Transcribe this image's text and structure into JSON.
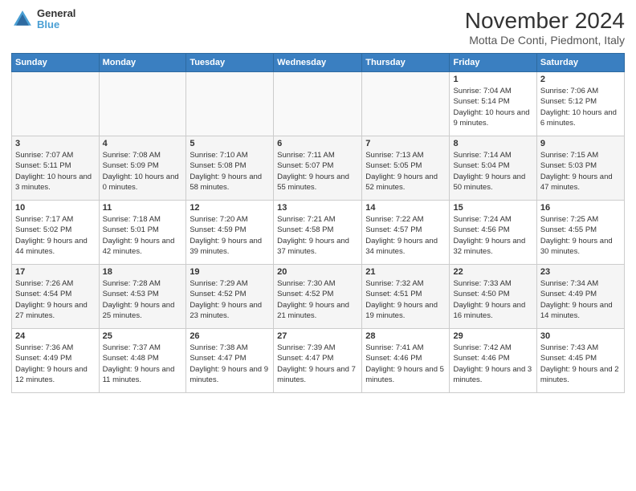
{
  "header": {
    "logo": {
      "line1": "General",
      "line2": "Blue"
    },
    "title": "November 2024",
    "subtitle": "Motta De Conti, Piedmont, Italy"
  },
  "weekdays": [
    "Sunday",
    "Monday",
    "Tuesday",
    "Wednesday",
    "Thursday",
    "Friday",
    "Saturday"
  ],
  "weeks": [
    [
      {
        "day": "",
        "info": ""
      },
      {
        "day": "",
        "info": ""
      },
      {
        "day": "",
        "info": ""
      },
      {
        "day": "",
        "info": ""
      },
      {
        "day": "",
        "info": ""
      },
      {
        "day": "1",
        "info": "Sunrise: 7:04 AM\nSunset: 5:14 PM\nDaylight: 10 hours and 9 minutes."
      },
      {
        "day": "2",
        "info": "Sunrise: 7:06 AM\nSunset: 5:12 PM\nDaylight: 10 hours and 6 minutes."
      }
    ],
    [
      {
        "day": "3",
        "info": "Sunrise: 7:07 AM\nSunset: 5:11 PM\nDaylight: 10 hours and 3 minutes."
      },
      {
        "day": "4",
        "info": "Sunrise: 7:08 AM\nSunset: 5:09 PM\nDaylight: 10 hours and 0 minutes."
      },
      {
        "day": "5",
        "info": "Sunrise: 7:10 AM\nSunset: 5:08 PM\nDaylight: 9 hours and 58 minutes."
      },
      {
        "day": "6",
        "info": "Sunrise: 7:11 AM\nSunset: 5:07 PM\nDaylight: 9 hours and 55 minutes."
      },
      {
        "day": "7",
        "info": "Sunrise: 7:13 AM\nSunset: 5:05 PM\nDaylight: 9 hours and 52 minutes."
      },
      {
        "day": "8",
        "info": "Sunrise: 7:14 AM\nSunset: 5:04 PM\nDaylight: 9 hours and 50 minutes."
      },
      {
        "day": "9",
        "info": "Sunrise: 7:15 AM\nSunset: 5:03 PM\nDaylight: 9 hours and 47 minutes."
      }
    ],
    [
      {
        "day": "10",
        "info": "Sunrise: 7:17 AM\nSunset: 5:02 PM\nDaylight: 9 hours and 44 minutes."
      },
      {
        "day": "11",
        "info": "Sunrise: 7:18 AM\nSunset: 5:01 PM\nDaylight: 9 hours and 42 minutes."
      },
      {
        "day": "12",
        "info": "Sunrise: 7:20 AM\nSunset: 4:59 PM\nDaylight: 9 hours and 39 minutes."
      },
      {
        "day": "13",
        "info": "Sunrise: 7:21 AM\nSunset: 4:58 PM\nDaylight: 9 hours and 37 minutes."
      },
      {
        "day": "14",
        "info": "Sunrise: 7:22 AM\nSunset: 4:57 PM\nDaylight: 9 hours and 34 minutes."
      },
      {
        "day": "15",
        "info": "Sunrise: 7:24 AM\nSunset: 4:56 PM\nDaylight: 9 hours and 32 minutes."
      },
      {
        "day": "16",
        "info": "Sunrise: 7:25 AM\nSunset: 4:55 PM\nDaylight: 9 hours and 30 minutes."
      }
    ],
    [
      {
        "day": "17",
        "info": "Sunrise: 7:26 AM\nSunset: 4:54 PM\nDaylight: 9 hours and 27 minutes."
      },
      {
        "day": "18",
        "info": "Sunrise: 7:28 AM\nSunset: 4:53 PM\nDaylight: 9 hours and 25 minutes."
      },
      {
        "day": "19",
        "info": "Sunrise: 7:29 AM\nSunset: 4:52 PM\nDaylight: 9 hours and 23 minutes."
      },
      {
        "day": "20",
        "info": "Sunrise: 7:30 AM\nSunset: 4:52 PM\nDaylight: 9 hours and 21 minutes."
      },
      {
        "day": "21",
        "info": "Sunrise: 7:32 AM\nSunset: 4:51 PM\nDaylight: 9 hours and 19 minutes."
      },
      {
        "day": "22",
        "info": "Sunrise: 7:33 AM\nSunset: 4:50 PM\nDaylight: 9 hours and 16 minutes."
      },
      {
        "day": "23",
        "info": "Sunrise: 7:34 AM\nSunset: 4:49 PM\nDaylight: 9 hours and 14 minutes."
      }
    ],
    [
      {
        "day": "24",
        "info": "Sunrise: 7:36 AM\nSunset: 4:49 PM\nDaylight: 9 hours and 12 minutes."
      },
      {
        "day": "25",
        "info": "Sunrise: 7:37 AM\nSunset: 4:48 PM\nDaylight: 9 hours and 11 minutes."
      },
      {
        "day": "26",
        "info": "Sunrise: 7:38 AM\nSunset: 4:47 PM\nDaylight: 9 hours and 9 minutes."
      },
      {
        "day": "27",
        "info": "Sunrise: 7:39 AM\nSunset: 4:47 PM\nDaylight: 9 hours and 7 minutes."
      },
      {
        "day": "28",
        "info": "Sunrise: 7:41 AM\nSunset: 4:46 PM\nDaylight: 9 hours and 5 minutes."
      },
      {
        "day": "29",
        "info": "Sunrise: 7:42 AM\nSunset: 4:46 PM\nDaylight: 9 hours and 3 minutes."
      },
      {
        "day": "30",
        "info": "Sunrise: 7:43 AM\nSunset: 4:45 PM\nDaylight: 9 hours and 2 minutes."
      }
    ]
  ]
}
